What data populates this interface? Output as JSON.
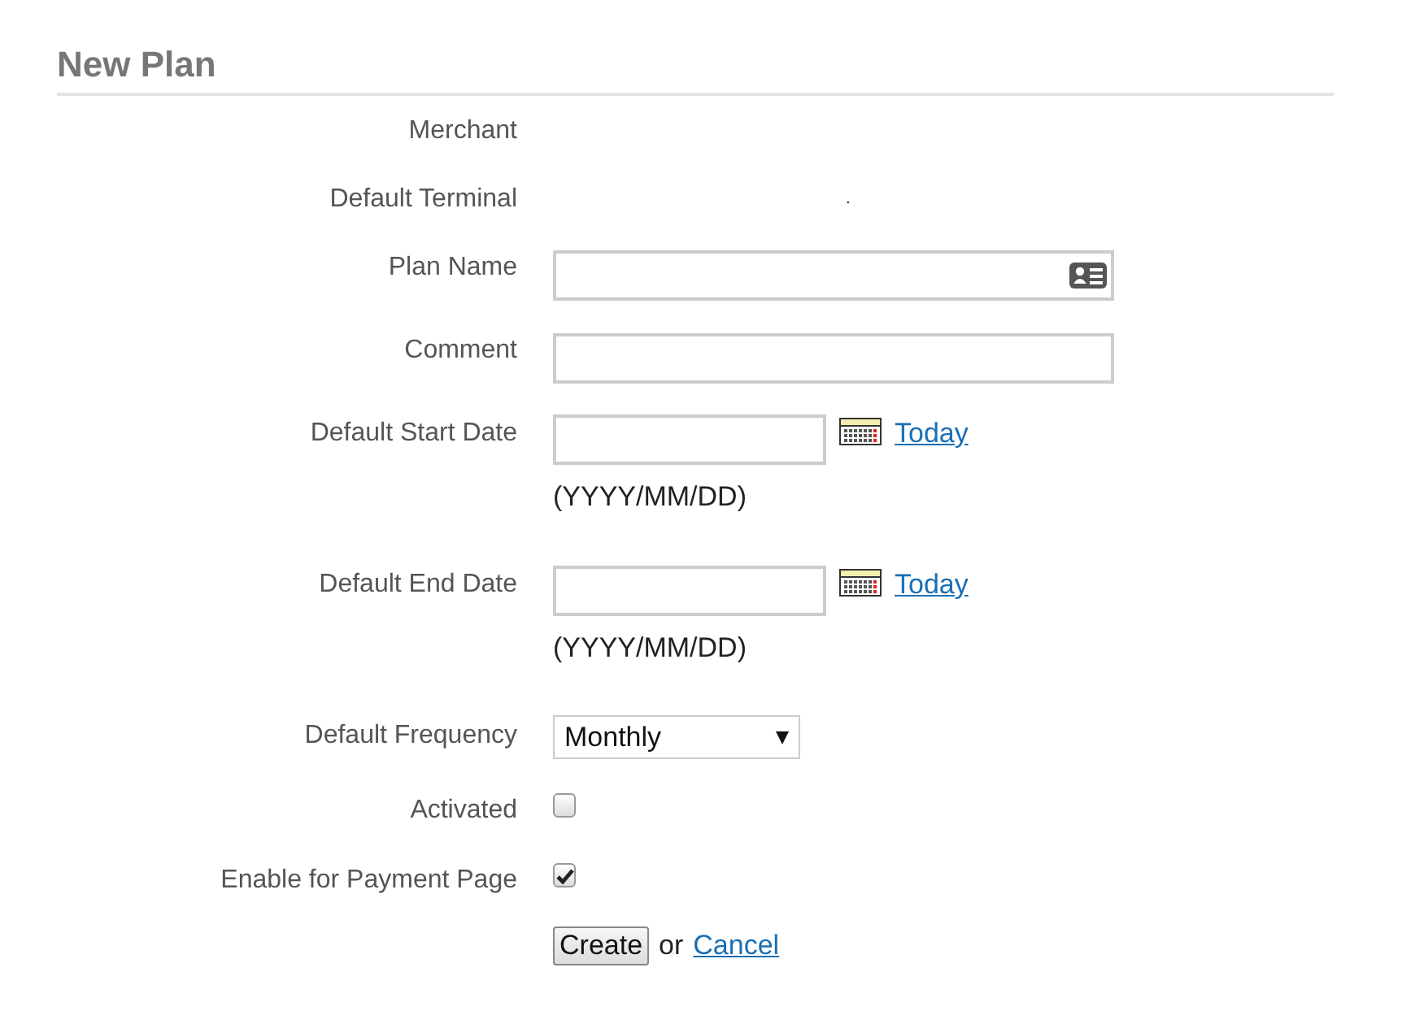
{
  "title": "New Plan",
  "fields": [
    {
      "kind": "text",
      "label": "Merchant"
    },
    {
      "kind": "text",
      "label": "Default Terminal",
      "value": "."
    },
    {
      "kind": "input",
      "label": "Plan Name",
      "card_icon": true
    },
    {
      "kind": "input",
      "label": "Comment",
      "card_icon": false
    },
    {
      "kind": "date",
      "label": "Default Start Date",
      "link": "Today",
      "hint": "(YYYY/MM/DD)"
    },
    {
      "kind": "date",
      "label": "Default End Date",
      "link": "Today",
      "hint": "(YYYY/MM/DD)"
    },
    {
      "kind": "select",
      "label": "Default Frequency",
      "value": "Monthly"
    },
    {
      "kind": "checkbox",
      "label": "Activated",
      "checked": false
    },
    {
      "kind": "checkbox",
      "label": "Enable for Payment Page",
      "checked": true
    }
  ],
  "actions": {
    "button": "Create",
    "separator": "or",
    "link": "Cancel"
  }
}
